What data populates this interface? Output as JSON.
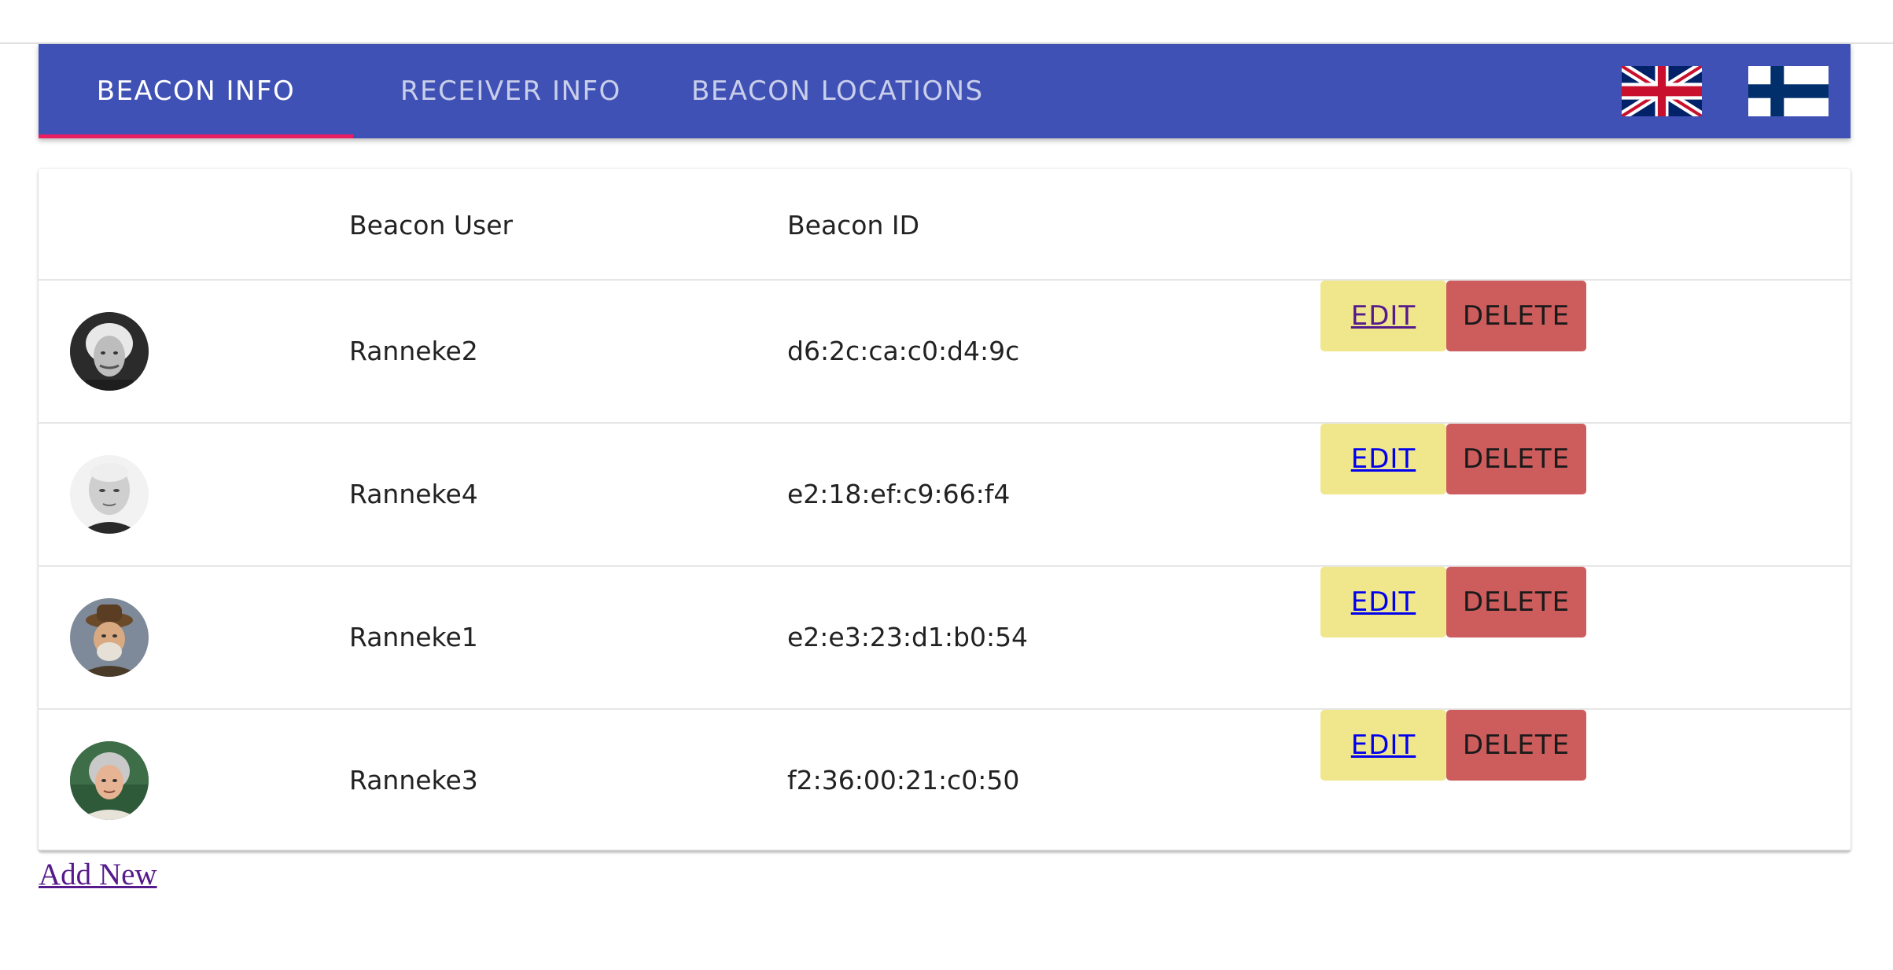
{
  "tabs": [
    {
      "label": "BEACON INFO",
      "active": true
    },
    {
      "label": "RECEIVER INFO",
      "active": false
    },
    {
      "label": "BEACON LOCATIONS",
      "active": false
    }
  ],
  "languages": [
    "uk-flag-icon",
    "finland-flag-icon"
  ],
  "table": {
    "headers": {
      "user": "Beacon User",
      "id": "Beacon ID"
    },
    "rows": [
      {
        "avatar": "avatar-icon",
        "user": "Ranneke2",
        "id": "d6:2c:ca:c0:d4:9c",
        "edit": "EDIT",
        "delete": "DELETE"
      },
      {
        "avatar": "avatar-icon",
        "user": "Ranneke4",
        "id": "e2:18:ef:c9:66:f4",
        "edit": "EDIT",
        "delete": "DELETE"
      },
      {
        "avatar": "avatar-icon",
        "user": "Ranneke1",
        "id": "e2:e3:23:d1:b0:54",
        "edit": "EDIT",
        "delete": "DELETE"
      },
      {
        "avatar": "avatar-icon",
        "user": "Ranneke3",
        "id": "f2:36:00:21:c0:50",
        "edit": "EDIT",
        "delete": "DELETE"
      }
    ]
  },
  "add_new_label": "Add New",
  "colors": {
    "appbar": "#3f51b5",
    "tab_indicator": "#e91e63",
    "edit_button": "#f0e68c",
    "delete_button": "#cd5c5c",
    "link": "#0000ee",
    "visited_link": "#551a8b"
  }
}
